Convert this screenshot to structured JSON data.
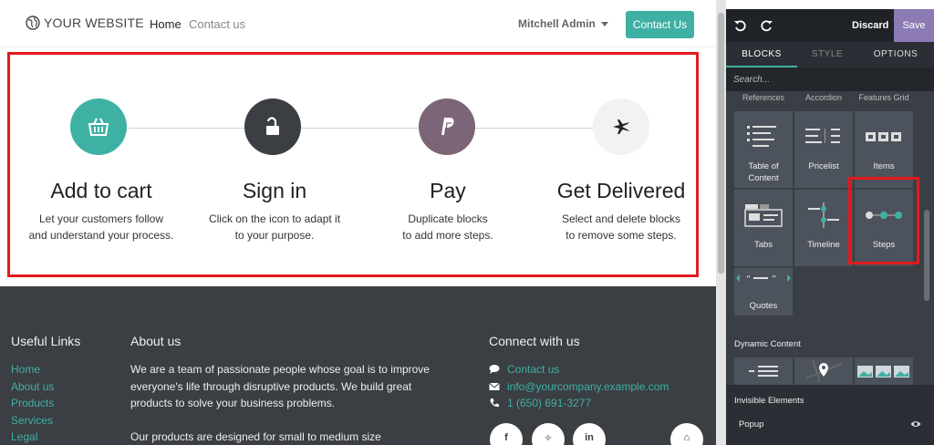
{
  "site": {
    "logo_text": "YOUR WEBSITE",
    "nav": {
      "home": "Home",
      "contact": "Contact us"
    },
    "user": "Mitchell Admin",
    "cta": "Contact Us",
    "accent": "#3fb1a4"
  },
  "steps": [
    {
      "title": "Add to cart",
      "desc1": "Let your customers follow",
      "desc2": "and understand your process.",
      "icon": "basket-icon",
      "color": "#3fb1a4"
    },
    {
      "title": "Sign in",
      "desc1": "Click on the icon to adapt it",
      "desc2": "to your purpose.",
      "icon": "unlock-icon",
      "color": "#3b3e43"
    },
    {
      "title": "Pay",
      "desc1": "Duplicate blocks",
      "desc2": "to add more steps.",
      "icon": "paypal-icon",
      "color": "#7c6576"
    },
    {
      "title": "Get Delivered",
      "desc1": "Select and delete blocks",
      "desc2": "to remove some steps.",
      "icon": "plane-icon",
      "color": "#f2f2f2"
    }
  ],
  "footer": {
    "links_title": "Useful Links",
    "links": [
      "Home",
      "About us",
      "Products",
      "Services",
      "Legal"
    ],
    "about_title": "About us",
    "about_p1": "We are a team of passionate people whose goal is to improve everyone's life through disruptive products. We build great products to solve your business problems.",
    "about_p2": "Our products are designed for small to medium size",
    "connect_title": "Connect with us",
    "contact_link": "Contact us",
    "email": "info@yourcompany.example.com",
    "phone": "1 (650) 691-3277",
    "social": [
      "f",
      "t",
      "in",
      "home"
    ]
  },
  "editor": {
    "discard": "Discard",
    "save": "Save",
    "tabs": {
      "blocks": "BLOCKS",
      "style": "STYLE",
      "options": "OPTIONS"
    },
    "search_placeholder": "Search...",
    "categories": [
      "References",
      "Accordion",
      "Features Grid"
    ],
    "blocks": {
      "toc_1": "Table of",
      "toc_2": "Content",
      "pricelist": "Pricelist",
      "items": "Items",
      "tabs": "Tabs",
      "timeline": "Timeline",
      "steps": "Steps",
      "quotes": "Quotes"
    },
    "dynamic_title": "Dynamic Content",
    "invisible_title": "Invisible Elements",
    "popup": "Popup",
    "highlight_color": "#e41a1c"
  }
}
